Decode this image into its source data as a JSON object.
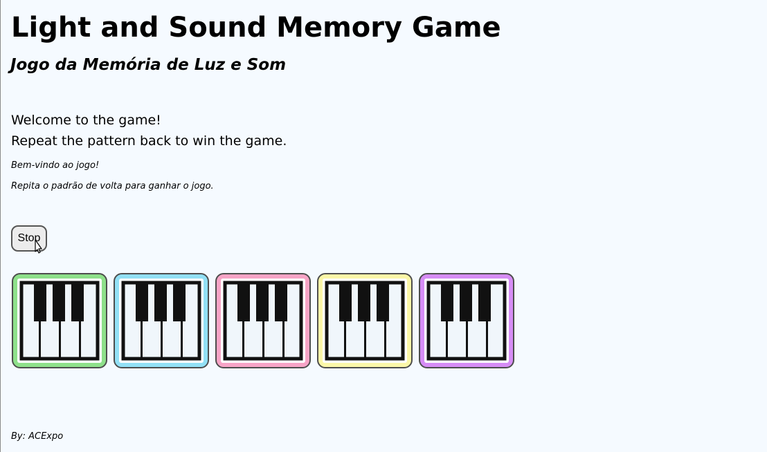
{
  "header": {
    "title": "Light and Sound Memory Game",
    "subtitle": "Jogo da Memória de Luz e Som"
  },
  "intro": {
    "line1": "Welcome to the game!",
    "line2": "Repeat the pattern back to win the game.",
    "line1_pt": "Bem-vindo ao jogo!",
    "line2_pt": "Repita o padrão de volta para ganhar o jogo."
  },
  "controls": {
    "stop_label": "Stop"
  },
  "pads": [
    {
      "color": "#8ee08a",
      "icon": "piano-keys-icon"
    },
    {
      "color": "#92e0f5",
      "icon": "piano-keys-icon"
    },
    {
      "color": "#f7a4c6",
      "icon": "piano-keys-icon"
    },
    {
      "color": "#fbf7a8",
      "icon": "piano-keys-icon"
    },
    {
      "color": "#d68cf5",
      "icon": "piano-keys-icon"
    }
  ],
  "footer": {
    "credit": "By: ACExpo"
  }
}
